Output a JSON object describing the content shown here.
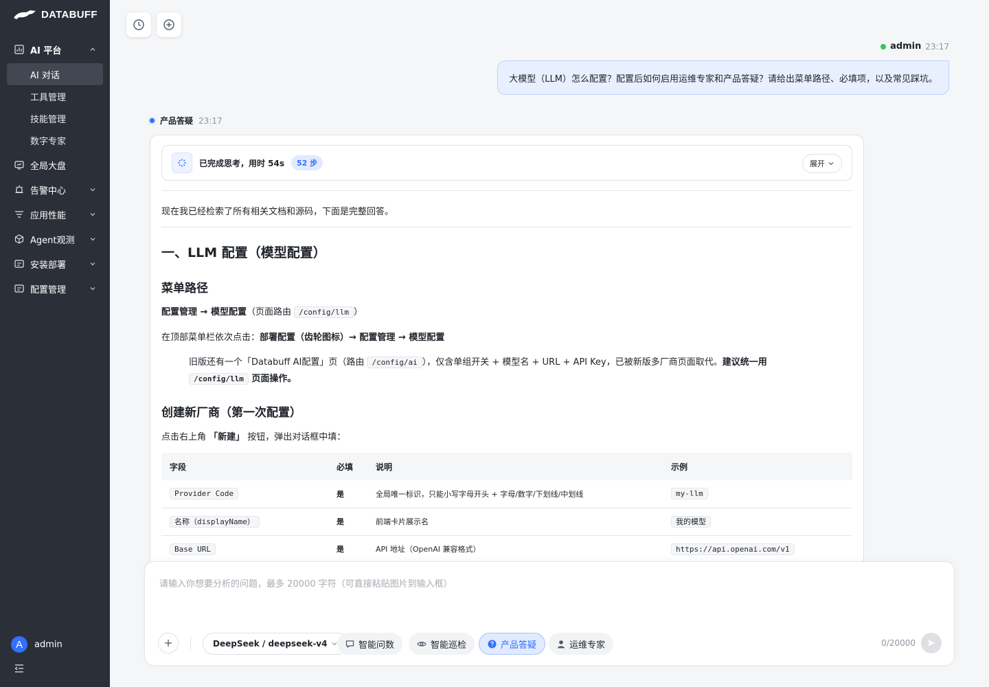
{
  "brand": {
    "name": "DATABUFF"
  },
  "sidebar": {
    "groups": [
      {
        "label": "AI 平台",
        "icon": "chart-icon",
        "expanded": true
      },
      {
        "label": "全局大盘",
        "icon": "dashboard-icon"
      },
      {
        "label": "告警中心",
        "icon": "alarm-icon"
      },
      {
        "label": "应用性能",
        "icon": "filter-icon"
      },
      {
        "label": "Agent观测",
        "icon": "cube-icon"
      },
      {
        "label": "安装部署",
        "icon": "install-icon"
      },
      {
        "label": "配置管理",
        "icon": "config-icon"
      }
    ],
    "ai_items": [
      {
        "label": "AI 对话",
        "active": true
      },
      {
        "label": "工具管理"
      },
      {
        "label": "技能管理"
      },
      {
        "label": "数字专家"
      }
    ],
    "user": {
      "initial": "A",
      "name": "admin"
    }
  },
  "chat": {
    "user_message": {
      "name": "admin",
      "time": "23:17",
      "text": "大模型（LLM）怎么配置？配置后如何启用运维专家和产品答疑？请给出菜单路径、必填项，以及常见踩坑。"
    },
    "bot": {
      "name": "产品答疑",
      "time": "23:17",
      "thinking": {
        "text": "已完成思考，用时 54s",
        "steps": "52 步",
        "expand_label": "展开"
      },
      "intro": "现在我已经检索了所有相关文档和源码，下面是完整回答。",
      "h1": "一、LLM 配置（模型配置）",
      "h2_menu": "菜单路径",
      "menu_path": {
        "bold": "配置管理 → 模型配置",
        "prefix": "（页面路由 ",
        "route": "/config/llm",
        "suffix": "）"
      },
      "menu_click": {
        "prefix": "在顶部菜单栏依次点击：",
        "bold": "部署配置（齿轮图标）→ 配置管理 → 模型配置"
      },
      "quote": {
        "p1": "旧版还有一个「Databuff AI配置」页（路由 ",
        "code1": "/config/ai",
        "p2": "），仅含单组开关 + 模型名 + URL + API Key，已被新版多厂商页面取代。",
        "bold1": "建议统一用",
        "code2": "/config/llm",
        "bold2": " 页面操作。"
      },
      "h2_create": "创建新厂商（第一次配置）",
      "create_intro": {
        "prefix": "点击右上角 ",
        "bold": "「新建」",
        "suffix": " 按钮，弹出对话框中填："
      },
      "table": {
        "headers": [
          "字段",
          "必填",
          "说明",
          "示例"
        ],
        "rows": [
          [
            "Provider Code",
            "是",
            "全局唯一标识，只能小写字母开头 + 字母/数字/下划线/中划线",
            "my-llm"
          ],
          [
            "名称（displayName）",
            "是",
            "前端卡片展示名",
            "我的模型"
          ],
          [
            "Base URL",
            "是",
            "API 地址（OpenAI 兼容格式）",
            "https://api.openai.com/v1"
          ]
        ]
      }
    }
  },
  "composer": {
    "placeholder": "请输入你想要分析的问题，最多 20000 字符（可直接粘贴图片到输入框）",
    "model": "DeepSeek / deepseek-v4",
    "modes": [
      {
        "label": "智能问数",
        "icon": "chat-icon"
      },
      {
        "label": "智能巡检",
        "icon": "eye-icon"
      },
      {
        "label": "产品答疑",
        "icon": "question-icon",
        "active": true
      },
      {
        "label": "运维专家",
        "icon": "person-icon"
      }
    ],
    "counter": "0/20000"
  },
  "colors": {
    "sidebar_bg": "#2b2f38",
    "accent": "#3370ff",
    "online": "#34c759"
  }
}
